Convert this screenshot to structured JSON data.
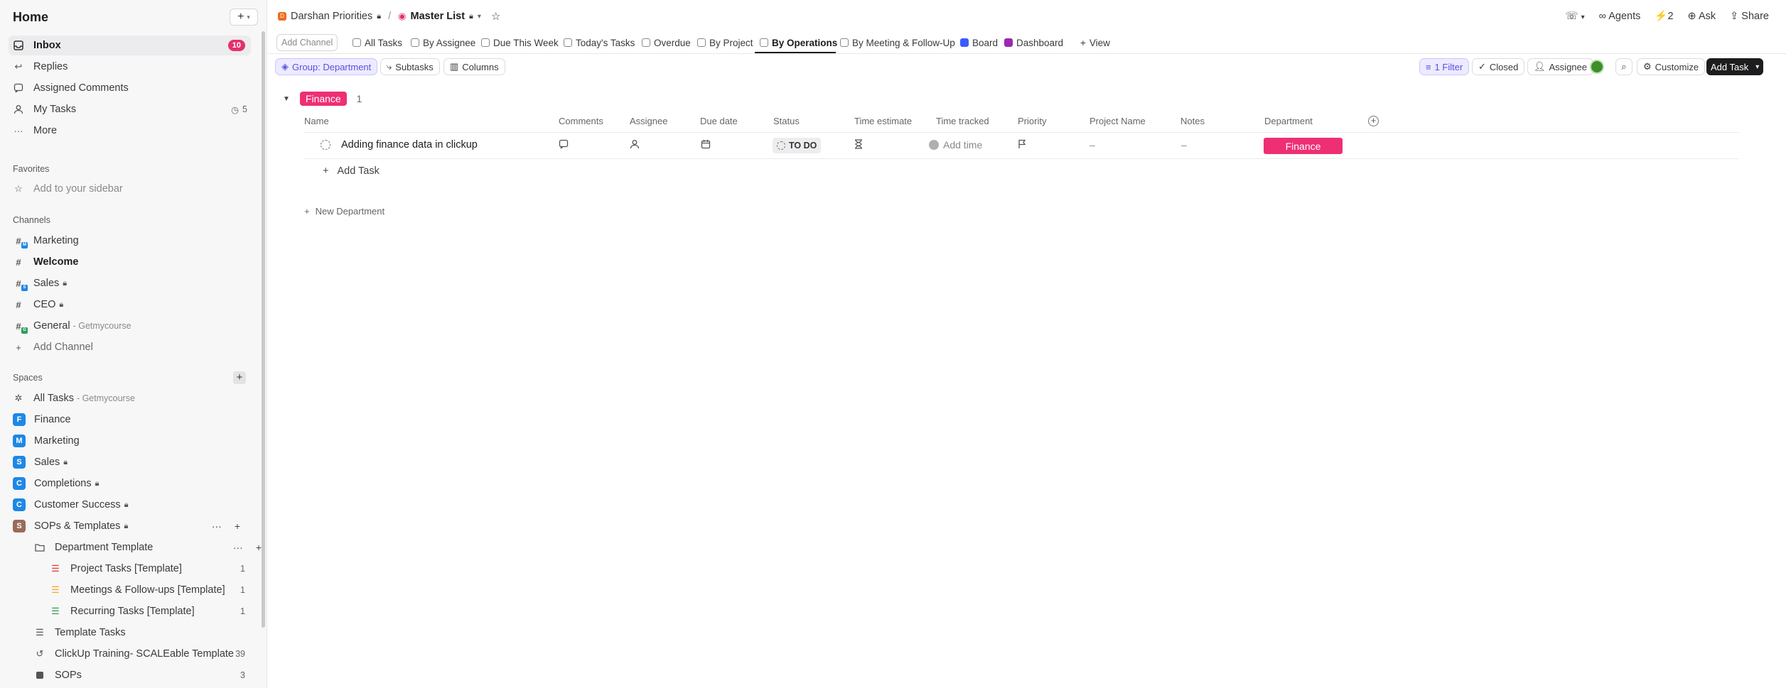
{
  "sidebar": {
    "title": "Home",
    "new_button": "+",
    "nav": [
      {
        "label": "Inbox",
        "badge": "10",
        "icon": "inbox-icon"
      },
      {
        "label": "Replies",
        "icon": "reply-icon"
      },
      {
        "label": "Assigned Comments",
        "icon": "comment-icon"
      },
      {
        "label": "My Tasks",
        "count": "5",
        "icon": "user-icon"
      },
      {
        "label": "More",
        "icon": "more-icon"
      }
    ],
    "favorites_title": "Favorites",
    "favorites_add": "Add to your sidebar",
    "channels_title": "Channels",
    "channels": [
      {
        "label": "Marketing",
        "sub": "",
        "lock": false
      },
      {
        "label": "Welcome",
        "sub": "",
        "lock": false
      },
      {
        "label": "Sales",
        "sub": "",
        "lock": true
      },
      {
        "label": "CEO",
        "sub": "",
        "lock": true
      },
      {
        "label": "General",
        "sub": "- Getmycourse",
        "lock": false
      }
    ],
    "add_channel": "Add Channel",
    "spaces_title": "Spaces",
    "all_tasks": {
      "label": "All Tasks",
      "sub": "- Getmycourse"
    },
    "spaces": [
      {
        "letter": "F",
        "label": "Finance",
        "color": "#1e88e5"
      },
      {
        "letter": "M",
        "label": "Marketing",
        "color": "#1e88e5"
      },
      {
        "letter": "S",
        "label": "Sales",
        "color": "#1e88e5"
      },
      {
        "letter": "C",
        "label": "Completions",
        "color": "#1e88e5"
      },
      {
        "letter": "C",
        "label": "Customer Success",
        "color": "#1e88e5"
      },
      {
        "letter": "S",
        "label": "SOPs & Templates",
        "color": "#9b6b5a"
      }
    ],
    "folder": "Department Template",
    "lists": [
      {
        "label": "Project Tasks [Template]",
        "count": "1",
        "color": "#e53935"
      },
      {
        "label": "Meetings & Follow-ups [Template]",
        "count": "1",
        "color": "#f5a623"
      },
      {
        "label": "Recurring Tasks [Template]",
        "count": "1",
        "color": "#2e9d5b"
      }
    ],
    "more_lists": [
      {
        "label": "Template Tasks",
        "count": ""
      },
      {
        "label": "ClickUp Training- SCALEable Template",
        "count": "39"
      },
      {
        "label": "SOPs",
        "count": "3"
      }
    ]
  },
  "topbar": {
    "space": "Darshan Priorities",
    "separator": "/",
    "list": "Master List",
    "agents": "Agents",
    "notifications": "2",
    "ask": "Ask",
    "share": "Share"
  },
  "tabs": {
    "add_channel": "Add Channel",
    "items": [
      "All Tasks",
      "By Assignee",
      "Due This Week",
      "Today's Tasks",
      "Overdue",
      "By Project",
      "By Operations",
      "By Meeting & Follow-Up",
      "Board",
      "Dashboard"
    ],
    "active": "By Operations",
    "view": "View"
  },
  "toolbar": {
    "group": "Group: Department",
    "subtasks": "Subtasks",
    "columns": "Columns",
    "filter": "1 Filter",
    "closed": "Closed",
    "assignee": "Assignee",
    "customize": "Customize",
    "add_task": "Add Task"
  },
  "group": {
    "name": "Finance",
    "count": "1"
  },
  "columns": [
    "Name",
    "Comments",
    "Assignee",
    "Due date",
    "Status",
    "Time estimate",
    "Time tracked",
    "Priority",
    "Project Name",
    "Notes",
    "Department"
  ],
  "task": {
    "name": "Adding finance data in clickup",
    "status": "TO DO",
    "time_tracked": "Add time",
    "project_name": "–",
    "notes": "–",
    "department": "Finance"
  },
  "add_task": "Add Task",
  "new_department": "New Department",
  "colors": {
    "accent_pink": "#ee2f74",
    "inbox_badge": "#e5306b",
    "group_chip": "#5b4fe0"
  }
}
